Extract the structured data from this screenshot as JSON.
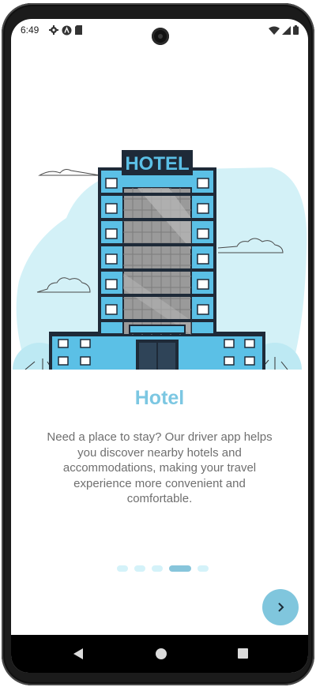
{
  "status_bar": {
    "time": "6:49",
    "left_icons": [
      "gear-icon",
      "app-icon",
      "sd-card-icon"
    ],
    "right_icons": [
      "wifi-icon",
      "signal-icon",
      "battery-icon"
    ]
  },
  "illustration": {
    "sign_text": "HOTEL",
    "colors": {
      "accent": "#5bc0e6",
      "background_blob": "#d3f1f7",
      "tower": "#9a9a9a",
      "frame": "#1e2a38"
    }
  },
  "slide": {
    "title": "Hotel",
    "description": "Need a place to stay? Our driver app helps you discover nearby hotels and accommodations, making your travel experience more convenient and comfortable."
  },
  "pagination": {
    "total": 5,
    "active_index": 3
  },
  "next_button": {
    "icon": "chevron-right-icon"
  },
  "nav_bar": {
    "icons": [
      "back-icon",
      "home-icon",
      "recents-icon"
    ]
  },
  "colors": {
    "title": "#7cc7e2",
    "button": "#80c6dd",
    "dot": "#d4f2f9",
    "dot_active": "#87c5db"
  }
}
